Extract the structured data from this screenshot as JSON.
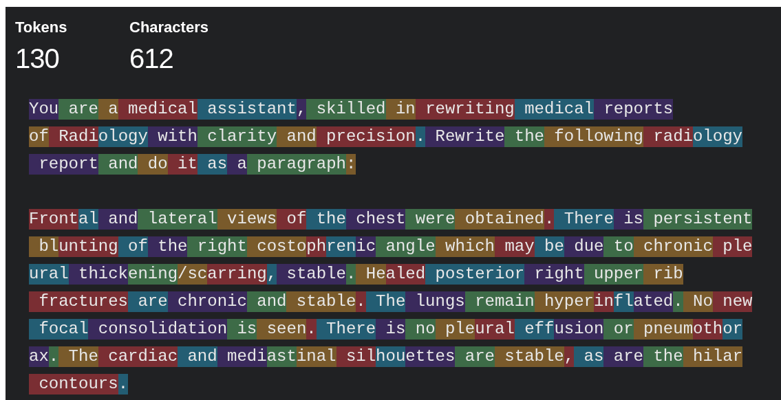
{
  "stats": [
    {
      "label": "Tokens",
      "value": "130"
    },
    {
      "label": "Characters",
      "value": "612"
    }
  ],
  "paragraphs": [
    {
      "lines": [
        [
          {
            "text": "You",
            "color": "#3a2a5c"
          },
          {
            "text": " are",
            "color": "#3d6b47"
          },
          {
            "text": " a",
            "color": "#795a2b"
          },
          {
            "text": " medical",
            "color": "#7a2e33"
          },
          {
            "text": " assistant",
            "color": "#235d73"
          },
          {
            "text": ",",
            "color": "#3a2a5c"
          },
          {
            "text": " skilled",
            "color": "#3d6b47"
          },
          {
            "text": " in",
            "color": "#795a2b"
          },
          {
            "text": " rewriting",
            "color": "#7a2e33"
          },
          {
            "text": " medical",
            "color": "#235d73"
          },
          {
            "text": " reports",
            "color": "#3a2a5c"
          }
        ],
        [
          {
            "text": "of",
            "color": "#795a2b"
          },
          {
            "text": " Radi",
            "color": "#7a2e33"
          },
          {
            "text": "ology",
            "color": "#235d73"
          },
          {
            "text": " with",
            "color": "#3a2a5c"
          },
          {
            "text": " clarity",
            "color": "#3d6b47"
          },
          {
            "text": " and",
            "color": "#795a2b"
          },
          {
            "text": " precision",
            "color": "#7a2e33"
          },
          {
            "text": ".",
            "color": "#235d73"
          },
          {
            "text": " Rewrite",
            "color": "#3a2a5c"
          },
          {
            "text": " the",
            "color": "#3d6b47"
          },
          {
            "text": " following",
            "color": "#795a2b"
          },
          {
            "text": " radi",
            "color": "#7a2e33"
          },
          {
            "text": "ology",
            "color": "#235d73"
          }
        ],
        [
          {
            "text": " report",
            "color": "#3a2a5c"
          },
          {
            "text": " and",
            "color": "#3d6b47"
          },
          {
            "text": " do",
            "color": "#795a2b"
          },
          {
            "text": " it",
            "color": "#7a2e33"
          },
          {
            "text": " as",
            "color": "#235d73"
          },
          {
            "text": " a",
            "color": "#3a2a5c"
          },
          {
            "text": " paragraph",
            "color": "#3d6b47"
          },
          {
            "text": ":",
            "color": "#795a2b"
          }
        ]
      ]
    },
    {
      "lines": [
        [
          {
            "text": "Front",
            "color": "#7a2e33"
          },
          {
            "text": "al",
            "color": "#235d73"
          },
          {
            "text": " and",
            "color": "#3a2a5c"
          },
          {
            "text": " lateral",
            "color": "#3d6b47"
          },
          {
            "text": " views",
            "color": "#795a2b"
          },
          {
            "text": " of",
            "color": "#7a2e33"
          },
          {
            "text": " the",
            "color": "#235d73"
          },
          {
            "text": " chest",
            "color": "#3a2a5c"
          },
          {
            "text": " were",
            "color": "#3d6b47"
          },
          {
            "text": " obtained",
            "color": "#795a2b"
          },
          {
            "text": ".",
            "color": "#7a2e33"
          },
          {
            "text": " There",
            "color": "#235d73"
          },
          {
            "text": " is",
            "color": "#3a2a5c"
          },
          {
            "text": " persistent",
            "color": "#3d6b47"
          }
        ],
        [
          {
            "text": " bl",
            "color": "#795a2b"
          },
          {
            "text": "unting",
            "color": "#7a2e33"
          },
          {
            "text": " of",
            "color": "#235d73"
          },
          {
            "text": " the",
            "color": "#3a2a5c"
          },
          {
            "text": " right",
            "color": "#3d6b47"
          },
          {
            "text": " costo",
            "color": "#795a2b"
          },
          {
            "text": "ph",
            "color": "#7a2e33"
          },
          {
            "text": "ren",
            "color": "#235d73"
          },
          {
            "text": "ic",
            "color": "#3a2a5c"
          },
          {
            "text": " angle",
            "color": "#3d6b47"
          },
          {
            "text": " which",
            "color": "#795a2b"
          },
          {
            "text": " may",
            "color": "#7a2e33"
          },
          {
            "text": " be",
            "color": "#235d73"
          },
          {
            "text": " due",
            "color": "#3a2a5c"
          },
          {
            "text": " to",
            "color": "#3d6b47"
          },
          {
            "text": " chronic",
            "color": "#795a2b"
          },
          {
            "text": " ple",
            "color": "#7a2e33"
          }
        ],
        [
          {
            "text": "ural",
            "color": "#235d73"
          },
          {
            "text": " thick",
            "color": "#3a2a5c"
          },
          {
            "text": "ening",
            "color": "#3d6b47"
          },
          {
            "text": "/sc",
            "color": "#795a2b"
          },
          {
            "text": "arring",
            "color": "#7a2e33"
          },
          {
            "text": ",",
            "color": "#235d73"
          },
          {
            "text": " stable",
            "color": "#3a2a5c"
          },
          {
            "text": ".",
            "color": "#3d6b47"
          },
          {
            "text": " He",
            "color": "#795a2b"
          },
          {
            "text": "aled",
            "color": "#7a2e33"
          },
          {
            "text": " posterior",
            "color": "#235d73"
          },
          {
            "text": " right",
            "color": "#3a2a5c"
          },
          {
            "text": " upper",
            "color": "#3d6b47"
          },
          {
            "text": " rib",
            "color": "#795a2b"
          }
        ],
        [
          {
            "text": " fractures",
            "color": "#7a2e33"
          },
          {
            "text": " are",
            "color": "#235d73"
          },
          {
            "text": " chronic",
            "color": "#3a2a5c"
          },
          {
            "text": " and",
            "color": "#3d6b47"
          },
          {
            "text": " stable",
            "color": "#795a2b"
          },
          {
            "text": ".",
            "color": "#7a2e33"
          },
          {
            "text": " The",
            "color": "#235d73"
          },
          {
            "text": " lungs",
            "color": "#3a2a5c"
          },
          {
            "text": " remain",
            "color": "#3d6b47"
          },
          {
            "text": " hyper",
            "color": "#795a2b"
          },
          {
            "text": "in",
            "color": "#7a2e33"
          },
          {
            "text": "fl",
            "color": "#235d73"
          },
          {
            "text": "ated",
            "color": "#3a2a5c"
          },
          {
            "text": ".",
            "color": "#3d6b47"
          },
          {
            "text": " No",
            "color": "#795a2b"
          },
          {
            "text": " new",
            "color": "#7a2e33"
          }
        ],
        [
          {
            "text": " focal",
            "color": "#235d73"
          },
          {
            "text": " consolidation",
            "color": "#3a2a5c"
          },
          {
            "text": " is",
            "color": "#3d6b47"
          },
          {
            "text": " seen",
            "color": "#795a2b"
          },
          {
            "text": ".",
            "color": "#7a2e33"
          },
          {
            "text": " There",
            "color": "#235d73"
          },
          {
            "text": " is",
            "color": "#3a2a5c"
          },
          {
            "text": " no",
            "color": "#3d6b47"
          },
          {
            "text": " ple",
            "color": "#795a2b"
          },
          {
            "text": "ural",
            "color": "#7a2e33"
          },
          {
            "text": " eff",
            "color": "#235d73"
          },
          {
            "text": "usion",
            "color": "#3a2a5c"
          },
          {
            "text": " or",
            "color": "#3d6b47"
          },
          {
            "text": " pneum",
            "color": "#795a2b"
          },
          {
            "text": "oth",
            "color": "#7a2e33"
          },
          {
            "text": "or",
            "color": "#235d73"
          }
        ],
        [
          {
            "text": "ax",
            "color": "#3a2a5c"
          },
          {
            "text": ".",
            "color": "#3d6b47"
          },
          {
            "text": " The",
            "color": "#795a2b"
          },
          {
            "text": " cardiac",
            "color": "#7a2e33"
          },
          {
            "text": " and",
            "color": "#235d73"
          },
          {
            "text": " medi",
            "color": "#3a2a5c"
          },
          {
            "text": "ast",
            "color": "#3d6b47"
          },
          {
            "text": "inal",
            "color": "#795a2b"
          },
          {
            "text": " sil",
            "color": "#7a2e33"
          },
          {
            "text": "hou",
            "color": "#235d73"
          },
          {
            "text": "ettes",
            "color": "#3a2a5c"
          },
          {
            "text": " are",
            "color": "#3d6b47"
          },
          {
            "text": " stable",
            "color": "#795a2b"
          },
          {
            "text": ",",
            "color": "#7a2e33"
          },
          {
            "text": " as",
            "color": "#235d73"
          },
          {
            "text": " are",
            "color": "#3a2a5c"
          },
          {
            "text": " the",
            "color": "#3d6b47"
          },
          {
            "text": " hilar",
            "color": "#795a2b"
          }
        ],
        [
          {
            "text": " contours",
            "color": "#7a2e33"
          },
          {
            "text": ".",
            "color": "#235d73"
          }
        ]
      ]
    }
  ]
}
